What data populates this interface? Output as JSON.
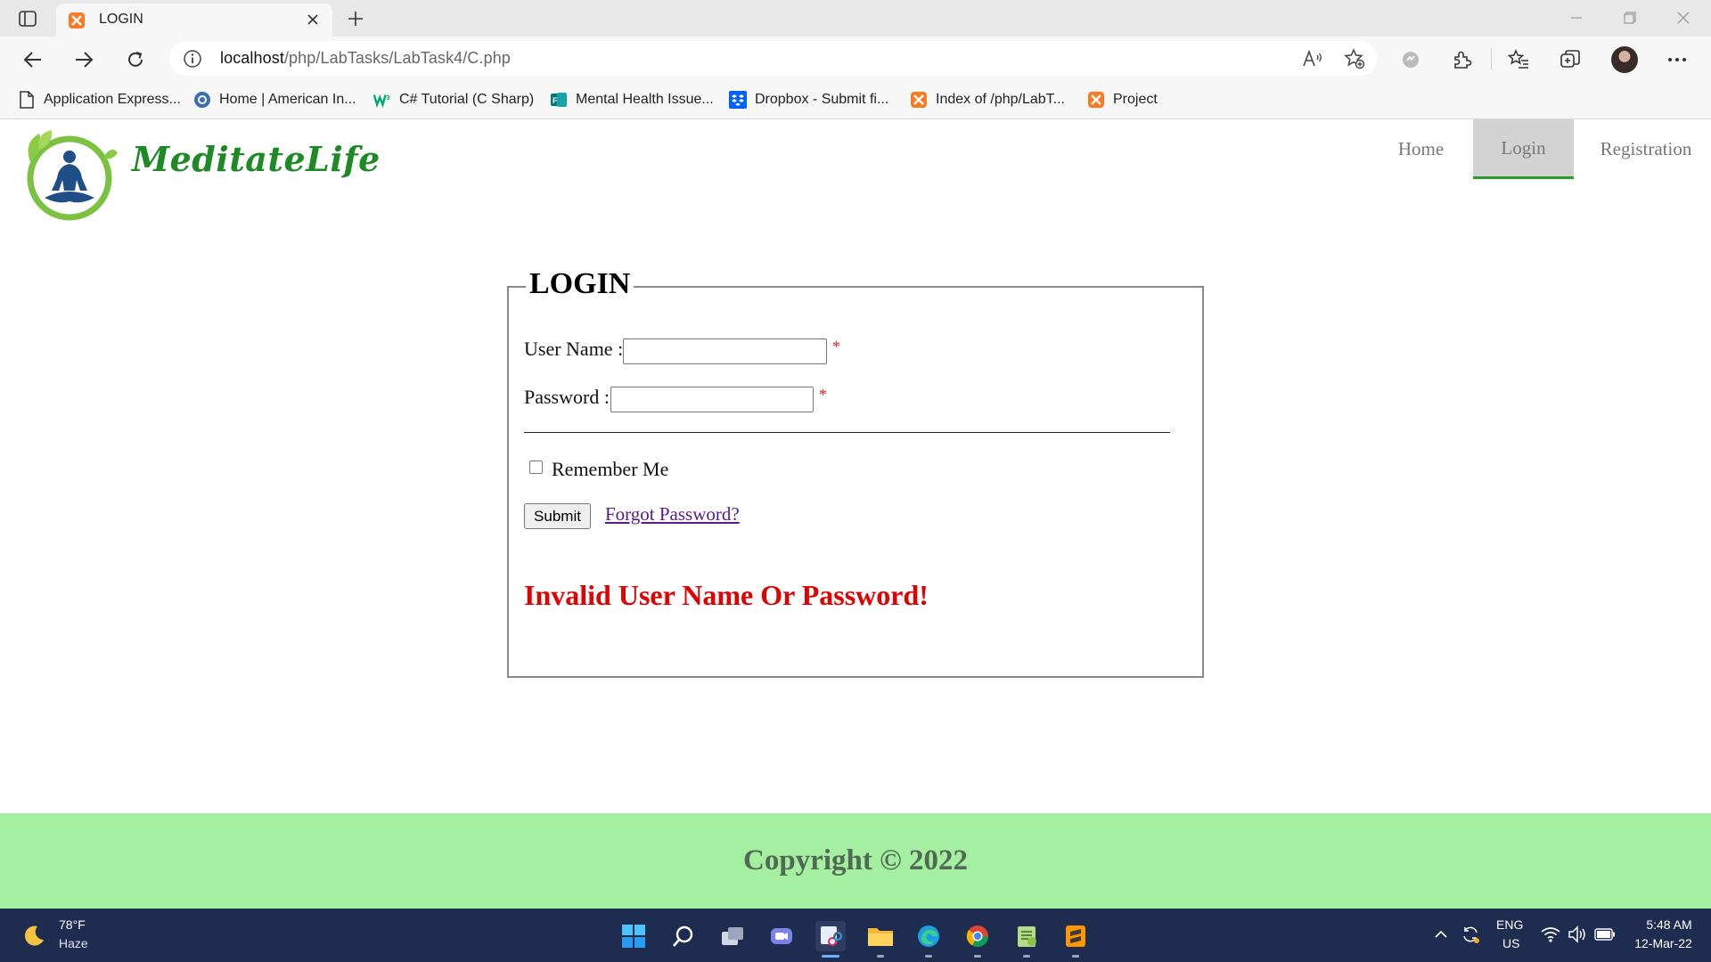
{
  "browser": {
    "tab_title": "LOGIN",
    "url_host": "localhost",
    "url_path": "/php/LabTasks/LabTask4/C.php",
    "bookmarks": [
      {
        "label": "Application Express...",
        "icon": "page-icon"
      },
      {
        "label": "Home | American In...",
        "icon": "globe-icon"
      },
      {
        "label": "C# Tutorial (C Sharp)",
        "icon": "w3schools-icon"
      },
      {
        "label": "Mental Health Issue...",
        "icon": "forms-icon"
      },
      {
        "label": "Dropbox - Submit fi...",
        "icon": "dropbox-icon"
      },
      {
        "label": "Index of /php/LabT...",
        "icon": "xampp-icon"
      },
      {
        "label": "Project",
        "icon": "xampp-icon"
      }
    ]
  },
  "site": {
    "logo_text": "MeditateLife",
    "nav": {
      "home": "Home",
      "login": "Login",
      "registration": "Registration"
    },
    "active_nav": "Login"
  },
  "form": {
    "legend": "LOGIN",
    "username_label": "User Name :",
    "username_value": "",
    "password_label": "Password :",
    "password_value": "",
    "required_mark": "*",
    "remember_label": "Remember Me",
    "remember_checked": false,
    "submit_label": "Submit",
    "forgot_label": "Forgot Password?",
    "error_message": "Invalid User Name Or Password!"
  },
  "footer": {
    "copyright": "Copyright © 2022"
  },
  "taskbar": {
    "weather_temp": "78°F",
    "weather_condition": "Haze",
    "lang_top": "ENG",
    "lang_bottom": "US",
    "time": "5:48 AM",
    "date": "12-Mar-22"
  },
  "colors": {
    "accent_green": "#1d8a26",
    "footer_bg": "#a4f0a0",
    "error_red": "#e00000",
    "required_red": "#e02020",
    "taskbar_bg": "#1d2c4f"
  }
}
